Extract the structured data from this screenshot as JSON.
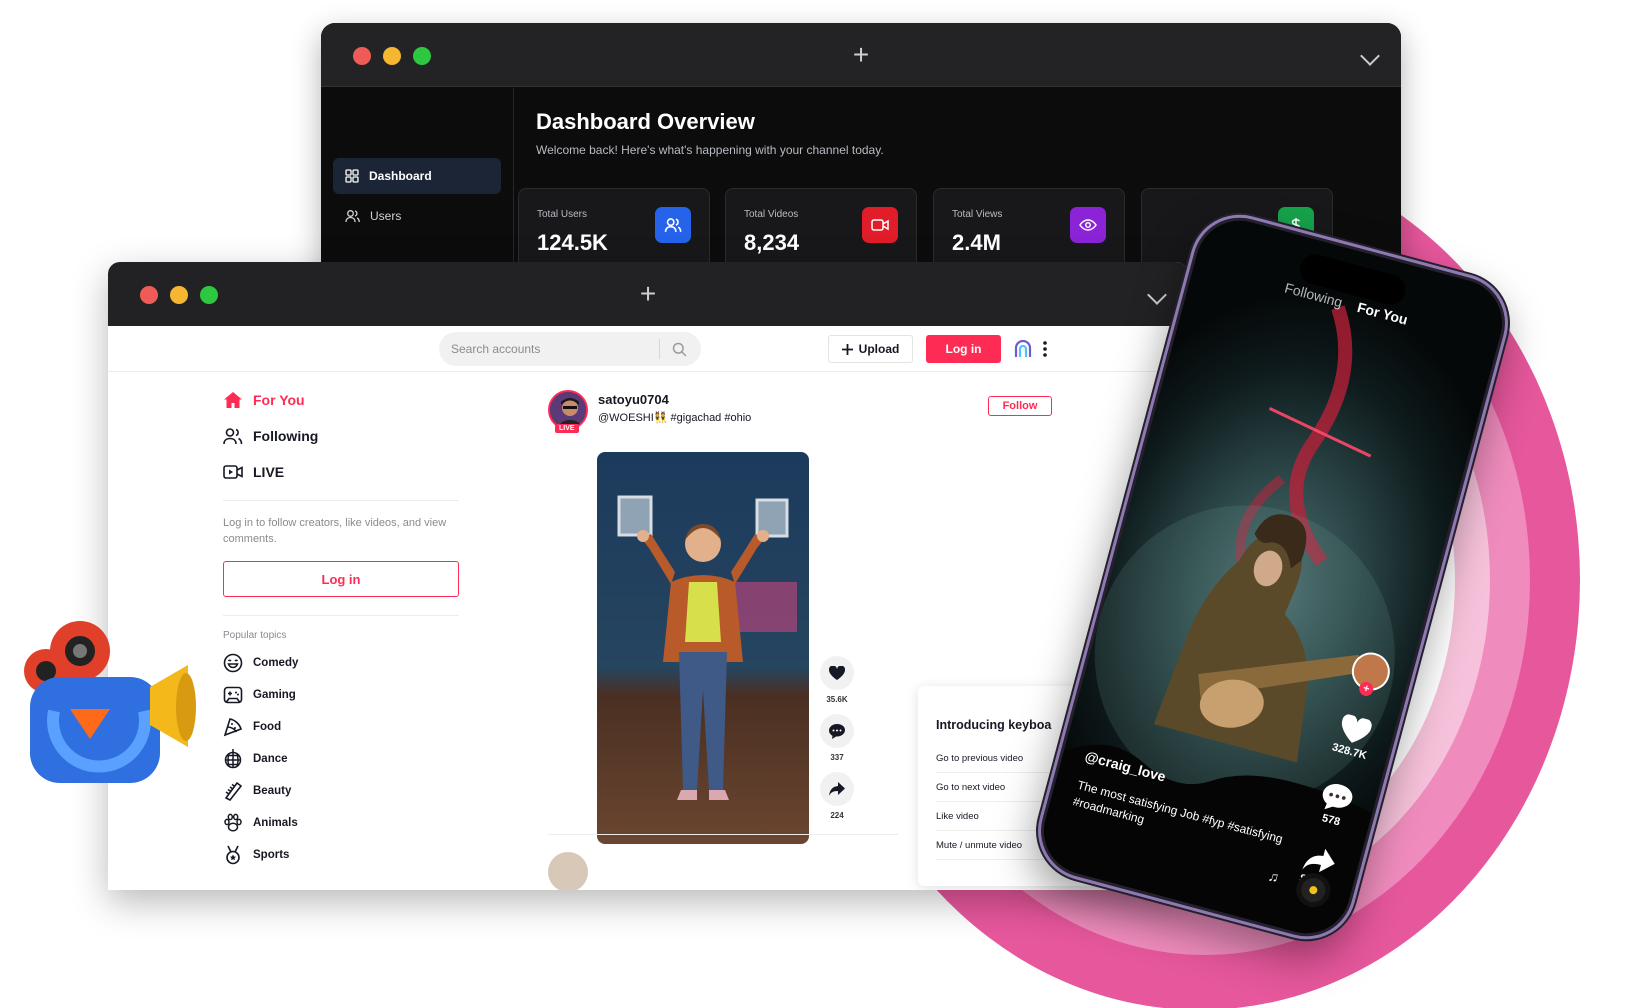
{
  "colors": {
    "brand": "#fe2c55",
    "pink_ring": "#e6579c",
    "dashboard_bg": "#0c0c0d",
    "stat_users": "#2563eb",
    "stat_videos": "#e11d2a",
    "stat_views": "#8b24d6"
  },
  "dashboard": {
    "title": "Dashboard Overview",
    "subtitle": "Welcome back! Here's what's happening with your channel today.",
    "nav": [
      {
        "label": "Dashboard",
        "icon": "grid-icon",
        "active": true
      },
      {
        "label": "Users",
        "icon": "users-icon",
        "active": false
      }
    ],
    "stats": [
      {
        "label": "Total Users",
        "value": "124.5K",
        "icon": "users-icon"
      },
      {
        "label": "Total Videos",
        "value": "8,234",
        "icon": "video-icon"
      },
      {
        "label": "Total Views",
        "value": "2.4M",
        "icon": "eye-icon"
      }
    ]
  },
  "web": {
    "search_placeholder": "Search accounts",
    "upload_label": "Upload",
    "login_label": "Log in",
    "nav": [
      {
        "label": "For You",
        "icon": "home-icon",
        "active": true
      },
      {
        "label": "Following",
        "icon": "following-icon",
        "active": false
      },
      {
        "label": "LIVE",
        "icon": "live-icon",
        "active": false
      }
    ],
    "login_note": "Log in to follow creators, like videos, and view comments.",
    "sidebar_login": "Log in",
    "topics_title": "Popular topics",
    "topics": [
      {
        "label": "Comedy",
        "icon": "smile-icon"
      },
      {
        "label": "Gaming",
        "icon": "gamepad-icon"
      },
      {
        "label": "Food",
        "icon": "pizza-icon"
      },
      {
        "label": "Dance",
        "icon": "disco-ball-icon"
      },
      {
        "label": "Beauty",
        "icon": "comb-icon"
      },
      {
        "label": "Animals",
        "icon": "paw-icon"
      },
      {
        "label": "Sports",
        "icon": "medal-icon"
      }
    ],
    "post": {
      "username": "satoyu0704",
      "caption": "@WOESHI👯 #gigachad #ohio",
      "live_badge": "LIVE",
      "follow_label": "Follow",
      "likes": "35.6K",
      "comments": "337",
      "shares": "224"
    },
    "keyboard": {
      "title": "Introducing keyboa",
      "items": [
        "Go to previous video",
        "Go to next video",
        "Like video",
        "Mute / unmute video"
      ]
    }
  },
  "phone": {
    "tab_following": "Following",
    "tab_foryou": "For You",
    "username": "@craig_love",
    "caption": "The most satisfying Job #fyp #satisfying #roadmarking",
    "likes": "328.7K",
    "comments": "578",
    "share_label": "Share"
  }
}
